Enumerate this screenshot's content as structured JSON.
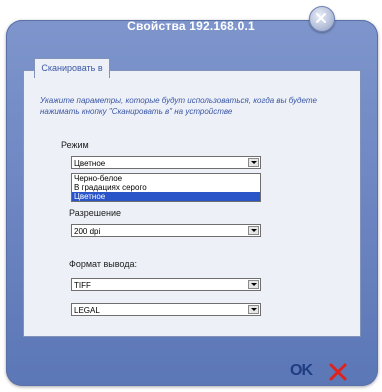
{
  "dialog": {
    "title": "Свойства 192.168.0.1"
  },
  "tabs": [
    {
      "label": "Сканировать в",
      "active": true
    }
  ],
  "instructions": "Укажите параметры, которые будут использоваться, когда вы будете нажимать кнопку \"Сканировать в\" на устройстве",
  "mode": {
    "label": "Режим",
    "value": "Цветное",
    "options": [
      "Черно-белое",
      "В градациях серого",
      "Цветное"
    ],
    "highlighted": "Цветное"
  },
  "resolution": {
    "label": "Разрешение",
    "value": "200 dpi"
  },
  "output": {
    "label": "Формат вывода:",
    "format_value": "TIFF",
    "size_value": "LEGAL"
  },
  "buttons": {
    "ok": "OK"
  },
  "colors": {
    "title_bar": "#6b84c1",
    "panel_bg": "#edf0f6",
    "selection": "#2a55c9",
    "cancel_red": "#e0221d"
  }
}
